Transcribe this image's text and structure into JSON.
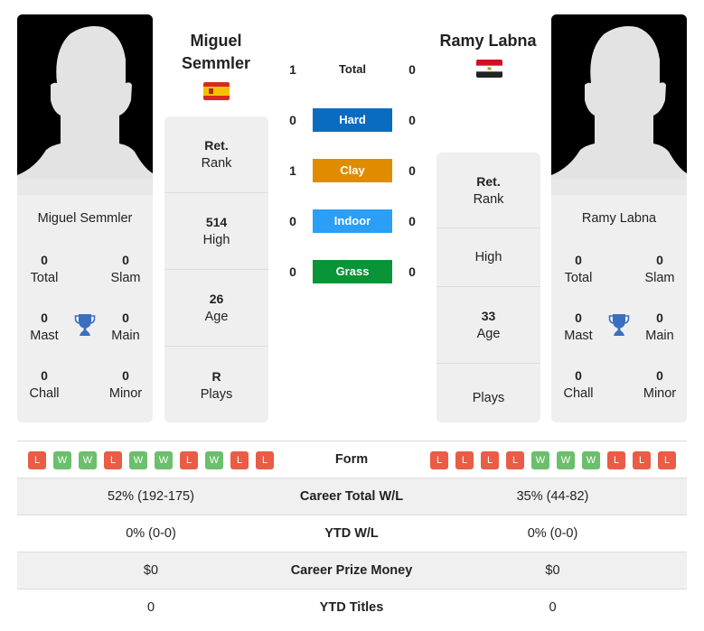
{
  "player1": {
    "name": "Miguel Semmler",
    "name_line1": "Miguel",
    "name_line2": "Semmler",
    "flag": "spain-flag",
    "card_name": "Miguel Semmler",
    "titles": {
      "total": "0",
      "total_label": "Total",
      "slam": "0",
      "slam_label": "Slam",
      "mast": "0",
      "mast_label": "Mast",
      "main": "0",
      "main_label": "Main",
      "chall": "0",
      "chall_label": "Chall",
      "minor": "0",
      "minor_label": "Minor"
    },
    "stats": [
      {
        "value": "Ret.",
        "label": "Rank"
      },
      {
        "value": "514",
        "label": "High"
      },
      {
        "value": "26",
        "label": "Age"
      },
      {
        "value": "R",
        "label": "Plays"
      }
    ],
    "form": [
      "L",
      "W",
      "W",
      "L",
      "W",
      "W",
      "L",
      "W",
      "L",
      "L"
    ]
  },
  "player2": {
    "name": "Ramy Labna",
    "flag": "egypt-flag",
    "card_name": "Ramy Labna",
    "titles": {
      "total": "0",
      "total_label": "Total",
      "slam": "0",
      "slam_label": "Slam",
      "mast": "0",
      "mast_label": "Mast",
      "main": "0",
      "main_label": "Main",
      "chall": "0",
      "chall_label": "Chall",
      "minor": "0",
      "minor_label": "Minor"
    },
    "stats": [
      {
        "value": "Ret.",
        "label": "Rank"
      },
      {
        "value": "",
        "label": "High"
      },
      {
        "value": "33",
        "label": "Age"
      },
      {
        "value": "",
        "label": "Plays"
      }
    ],
    "form": [
      "L",
      "L",
      "L",
      "L",
      "W",
      "W",
      "W",
      "L",
      "L",
      "L"
    ]
  },
  "h2h": [
    {
      "label": "Total",
      "p1": "1",
      "p2": "0",
      "color": ""
    },
    {
      "label": "Hard",
      "p1": "0",
      "p2": "0",
      "color": "#0a6cc1"
    },
    {
      "label": "Clay",
      "p1": "1",
      "p2": "0",
      "color": "#e08c00"
    },
    {
      "label": "Indoor",
      "p1": "0",
      "p2": "0",
      "color": "#2b9ef5"
    },
    {
      "label": "Grass",
      "p1": "0",
      "p2": "0",
      "color": "#0a9438"
    }
  ],
  "table": {
    "form_label": "Form",
    "rows": [
      {
        "label": "Career Total W/L",
        "p1": "52% (192-175)",
        "p2": "35% (44-82)"
      },
      {
        "label": "YTD W/L",
        "p1": "0% (0-0)",
        "p2": "0% (0-0)"
      },
      {
        "label": "Career Prize Money",
        "p1": "$0",
        "p2": "$0"
      },
      {
        "label": "YTD Titles",
        "p1": "0",
        "p2": "0"
      }
    ]
  },
  "colors": {
    "loss": "#e95c46",
    "win": "#6cbf6c",
    "trophy": "#3a6fc0"
  }
}
